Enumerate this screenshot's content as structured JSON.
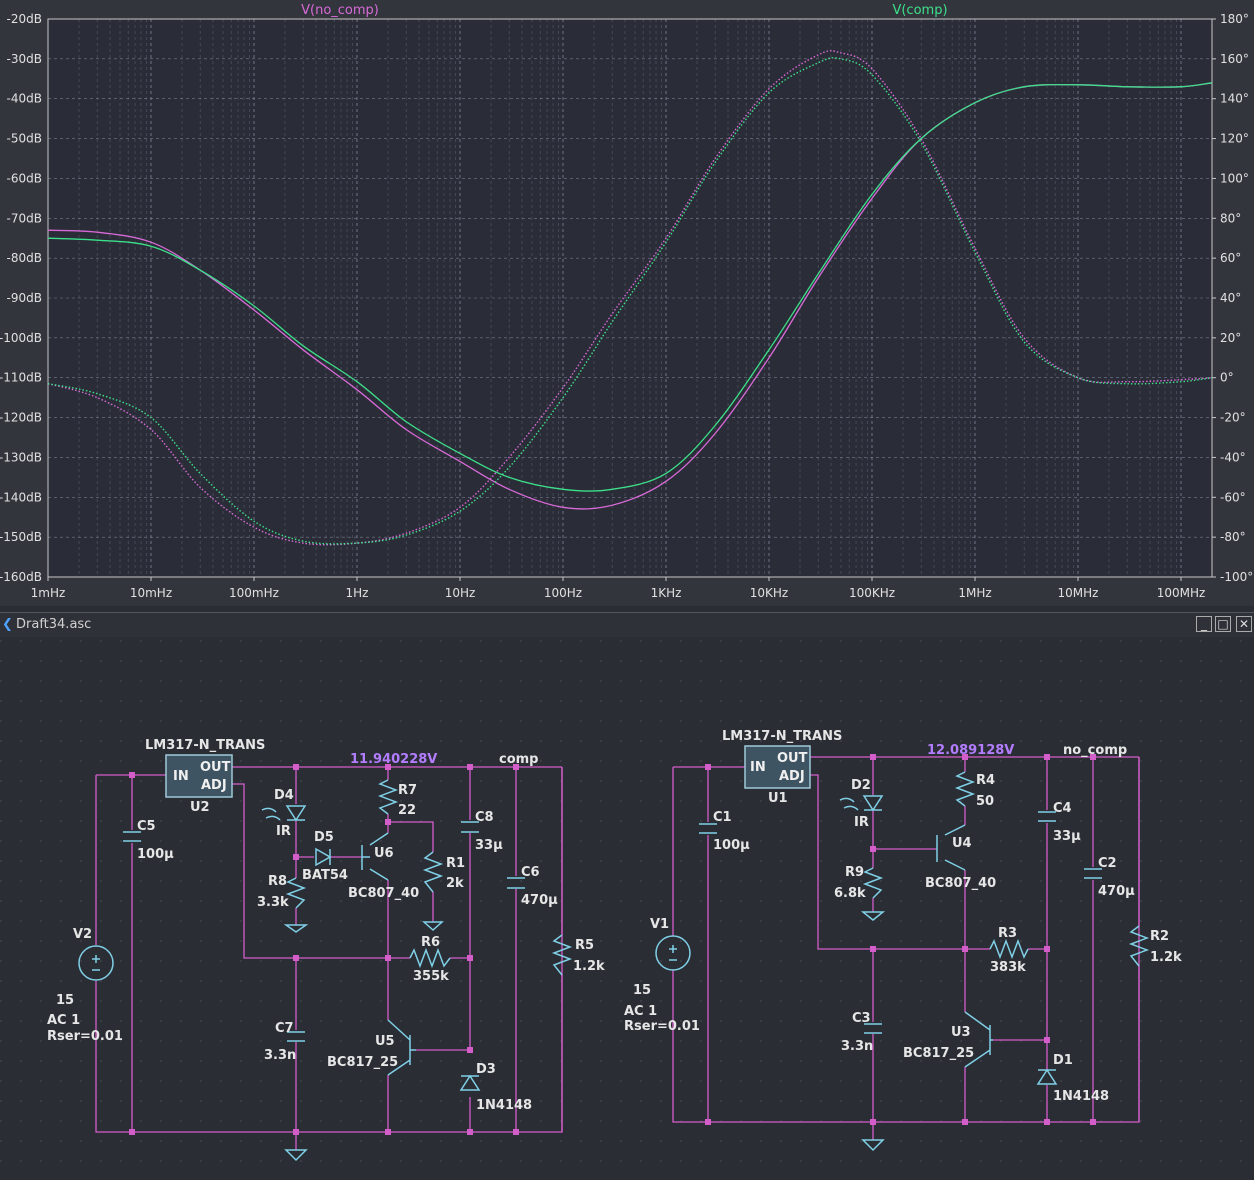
{
  "window": {
    "title": "Draft34.asc"
  },
  "colors": {
    "no_comp": "#d86ad8",
    "comp": "#3de08a",
    "wire": "#d35ec9",
    "component": "#7fd0e6",
    "label": "#e6e6e6",
    "netlabel": "#b27dff",
    "grid": "#8a8fa6"
  },
  "chart_data": {
    "type": "line",
    "x_scale": "log",
    "x_ticks": [
      "1mHz",
      "10mHz",
      "100mHz",
      "1Hz",
      "10Hz",
      "100Hz",
      "1KHz",
      "10KHz",
      "100KHz",
      "1MHz",
      "10MHz",
      "100MHz"
    ],
    "y_left_ticks": [
      "-20dB",
      "-30dB",
      "-40dB",
      "-50dB",
      "-60dB",
      "-70dB",
      "-80dB",
      "-90dB",
      "-100dB",
      "-110dB",
      "-120dB",
      "-130dB",
      "-140dB",
      "-150dB",
      "-160dB"
    ],
    "y_right_ticks": [
      "180°",
      "160°",
      "140°",
      "120°",
      "100°",
      "80°",
      "60°",
      "40°",
      "20°",
      "0°",
      "-20°",
      "-40°",
      "-60°",
      "-80°",
      "-100°"
    ],
    "xlim": [
      0.001,
      200000000
    ],
    "ylim_db": [
      -160,
      -20
    ],
    "ylim_deg": [
      -100,
      180
    ],
    "series": [
      {
        "name": "V(no_comp)",
        "trace": "magnitude",
        "x": [
          0.001,
          0.003,
          0.01,
          0.03,
          0.1,
          0.3,
          1,
          3,
          10,
          30,
          100,
          300,
          1000,
          3000,
          10000,
          30000,
          100000,
          300000,
          1000000,
          3000000,
          10000000,
          30000000,
          100000000,
          200000000
        ],
        "y": [
          -73,
          -73.5,
          -76,
          -83,
          -93,
          -103,
          -113,
          -123,
          -131,
          -138,
          -142.5,
          -142,
          -136,
          -124,
          -105,
          -85,
          -65,
          -50,
          -41,
          -37,
          -36.5,
          -37,
          -37,
          -36
        ]
      },
      {
        "name": "V(no_comp)",
        "trace": "phase",
        "x": [
          0.001,
          0.003,
          0.01,
          0.03,
          0.1,
          0.3,
          1,
          3,
          10,
          30,
          100,
          300,
          1000,
          3000,
          10000,
          30000,
          50000,
          100000,
          300000,
          1000000,
          3000000,
          10000000,
          30000000,
          100000000,
          200000000
        ],
        "y": [
          -3,
          -10,
          -26,
          -55,
          -75,
          -83,
          -83,
          -78,
          -65,
          -40,
          -5,
          32,
          70,
          110,
          145,
          162,
          163,
          155,
          120,
          65,
          20,
          0,
          -2,
          -1,
          0
        ]
      },
      {
        "name": "V(comp)",
        "trace": "magnitude",
        "x": [
          0.001,
          0.003,
          0.01,
          0.03,
          0.1,
          0.3,
          1,
          3,
          10,
          30,
          100,
          300,
          1000,
          3000,
          10000,
          30000,
          100000,
          300000,
          1000000,
          3000000,
          10000000,
          30000000,
          100000000,
          200000000
        ],
        "y": [
          -75,
          -75.5,
          -77,
          -83,
          -92,
          -102,
          -111,
          -121,
          -129,
          -135,
          -138,
          -138,
          -134,
          -122,
          -103,
          -84,
          -64,
          -50,
          -41,
          -37,
          -36.5,
          -37,
          -37,
          -36
        ]
      },
      {
        "name": "V(comp)",
        "trace": "phase",
        "x": [
          0.001,
          0.003,
          0.01,
          0.03,
          0.1,
          0.3,
          1,
          3,
          10,
          30,
          100,
          300,
          1000,
          3000,
          10000,
          30000,
          50000,
          100000,
          300000,
          1000000,
          3000000,
          10000000,
          30000000,
          100000000,
          200000000
        ],
        "y": [
          -3,
          -8,
          -20,
          -48,
          -72,
          -82,
          -83,
          -79,
          -67,
          -45,
          -10,
          28,
          68,
          108,
          143,
          158,
          160,
          152,
          118,
          63,
          18,
          0,
          -3,
          -2,
          0
        ]
      }
    ]
  },
  "schematic": {
    "left": {
      "reg_name": "LM317-N_TRANS",
      "reg_ref": "U2",
      "pin_in": "IN",
      "pin_out": "OUT",
      "pin_adj": "ADJ",
      "vout": "11.940228V",
      "net": "comp",
      "D4": {
        "ref": "D4",
        "val": "IR"
      },
      "D5": {
        "ref": "D5",
        "val": "BAT54"
      },
      "R7": {
        "ref": "R7",
        "val": "22"
      },
      "U6": {
        "ref": "U6",
        "val": "BC807_40"
      },
      "R1": {
        "ref": "R1",
        "val": "2k"
      },
      "C8": {
        "ref": "C8",
        "val": "33µ"
      },
      "C6": {
        "ref": "C6",
        "val": "470µ"
      },
      "R8": {
        "ref": "R8",
        "val": "3.3k"
      },
      "R6": {
        "ref": "R6",
        "val": "355k"
      },
      "R5": {
        "ref": "R5",
        "val": "1.2k"
      },
      "C5": {
        "ref": "C5",
        "val": "100µ"
      },
      "C7": {
        "ref": "C7",
        "val": "3.3n"
      },
      "U5": {
        "ref": "U5",
        "val": "BC817_25"
      },
      "D3": {
        "ref": "D3",
        "val": "1N4148"
      },
      "V2": {
        "ref": "V2",
        "dc": "15",
        "ac": "AC 1",
        "rser": "Rser=0.01"
      }
    },
    "right": {
      "reg_name": "LM317-N_TRANS",
      "reg_ref": "U1",
      "pin_in": "IN",
      "pin_out": "OUT",
      "pin_adj": "ADJ",
      "vout": "12.089128V",
      "net": "no_comp",
      "D2": {
        "ref": "D2",
        "val": "IR"
      },
      "R4": {
        "ref": "R4",
        "val": "50"
      },
      "U4": {
        "ref": "U4",
        "val": "BC807_40"
      },
      "C4": {
        "ref": "C4",
        "val": "33µ"
      },
      "C2": {
        "ref": "C2",
        "val": "470µ"
      },
      "C1": {
        "ref": "C1",
        "val": "100µ"
      },
      "R9": {
        "ref": "R9",
        "val": "6.8k"
      },
      "R3": {
        "ref": "R3",
        "val": "383k"
      },
      "R2": {
        "ref": "R2",
        "val": "1.2k"
      },
      "C3": {
        "ref": "C3",
        "val": "3.3n"
      },
      "U3": {
        "ref": "U3",
        "val": "BC817_25"
      },
      "D1": {
        "ref": "D1",
        "val": "1N4148"
      },
      "V1": {
        "ref": "V1",
        "dc": "15",
        "ac": "AC 1",
        "rser": "Rser=0.01"
      }
    }
  }
}
